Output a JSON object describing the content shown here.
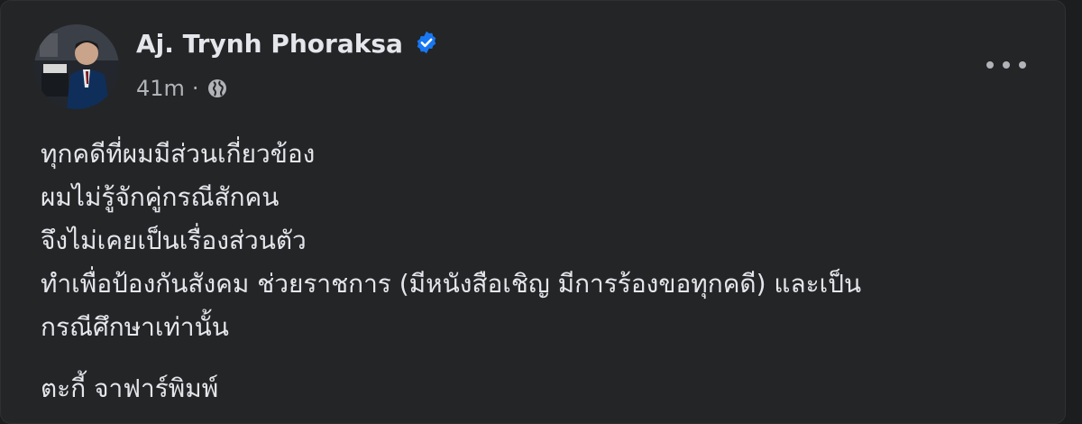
{
  "post": {
    "author": "Aj. Trynh Phoraksa",
    "timestamp": "41m",
    "separator": "·",
    "audience_icon": "globe-icon",
    "verified_icon": "verified-badge-icon",
    "menu_icon": "more-options-icon",
    "lines": [
      "ทุกคดีที่ผมมีส่วนเกี่ยวข้อง",
      "ผมไม่รู้จักคู่กรณีสักคน",
      "จึงไม่เคยเป็นเรื่องส่วนตัว",
      "ทำเพื่อป้องกันสังคม ช่วยราชการ (มีหนังสือเชิญ มีการร้องขอทุกคดี) และเป็น",
      "กรณีศึกษาเท่านั้น"
    ],
    "signature": "ตะกี้ จาฟาร์พิมพ์"
  },
  "colors": {
    "background": "#242526",
    "text_primary": "#e4e6eb",
    "text_secondary": "#b0b3b8",
    "verified_blue": "#1877f2"
  }
}
